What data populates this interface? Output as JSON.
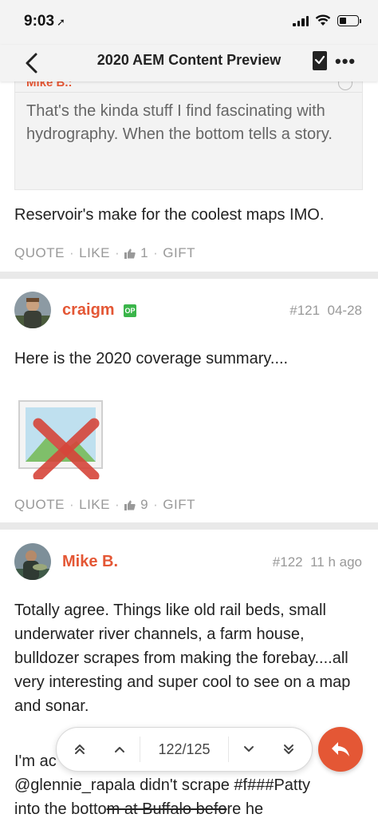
{
  "status_bar": {
    "time": "9:03",
    "location_glyph": "➚"
  },
  "nav": {
    "title": "2020 AEM Content Preview"
  },
  "quote": {
    "author": "Mike B.:",
    "text": "That's the kinda stuff I find fascinating with hydrography. When the bottom tells a story."
  },
  "post_top": {
    "text": "Reservoir's make for the coolest maps IMO.",
    "actions": {
      "quote": "QUOTE",
      "like": "LIKE",
      "like_count": "1",
      "gift": "GIFT"
    }
  },
  "post_121": {
    "username": "craigm",
    "badge": "OP",
    "number": "#121",
    "date": "04-28",
    "text": "Here is the 2020 coverage summary....",
    "actions": {
      "quote": "QUOTE",
      "like": "LIKE",
      "like_count": "9",
      "gift": "GIFT"
    }
  },
  "post_122": {
    "username": "Mike B.",
    "number": "#122",
    "date": "11 h ago",
    "text": "Totally agree. Things like old rail beds, small underwater river channels, a farm house, bulldozer scrapes from making the forebay....all very interesting and super cool to see on a map and sonar.",
    "text2_start": "I'm ac",
    "text2_line2": "@glennie_rapala didn't scrape #f###Patty",
    "text2_line3_a": "into the botto",
    "text2_line3_b": "m at Buffalo befo",
    "text2_line3_c": "re he"
  },
  "pager": {
    "position": "122/125"
  },
  "colors": {
    "accent": "#e45735",
    "op_badge": "#3ab54a",
    "muted": "#999999"
  },
  "icons": [
    "back-chevron-icon",
    "bookmark-icon",
    "more-dots-icon",
    "thumb-up-icon",
    "broken-image-icon",
    "double-chevron-up-icon",
    "chevron-up-icon",
    "chevron-down-icon",
    "double-chevron-down-icon",
    "reply-icon"
  ]
}
